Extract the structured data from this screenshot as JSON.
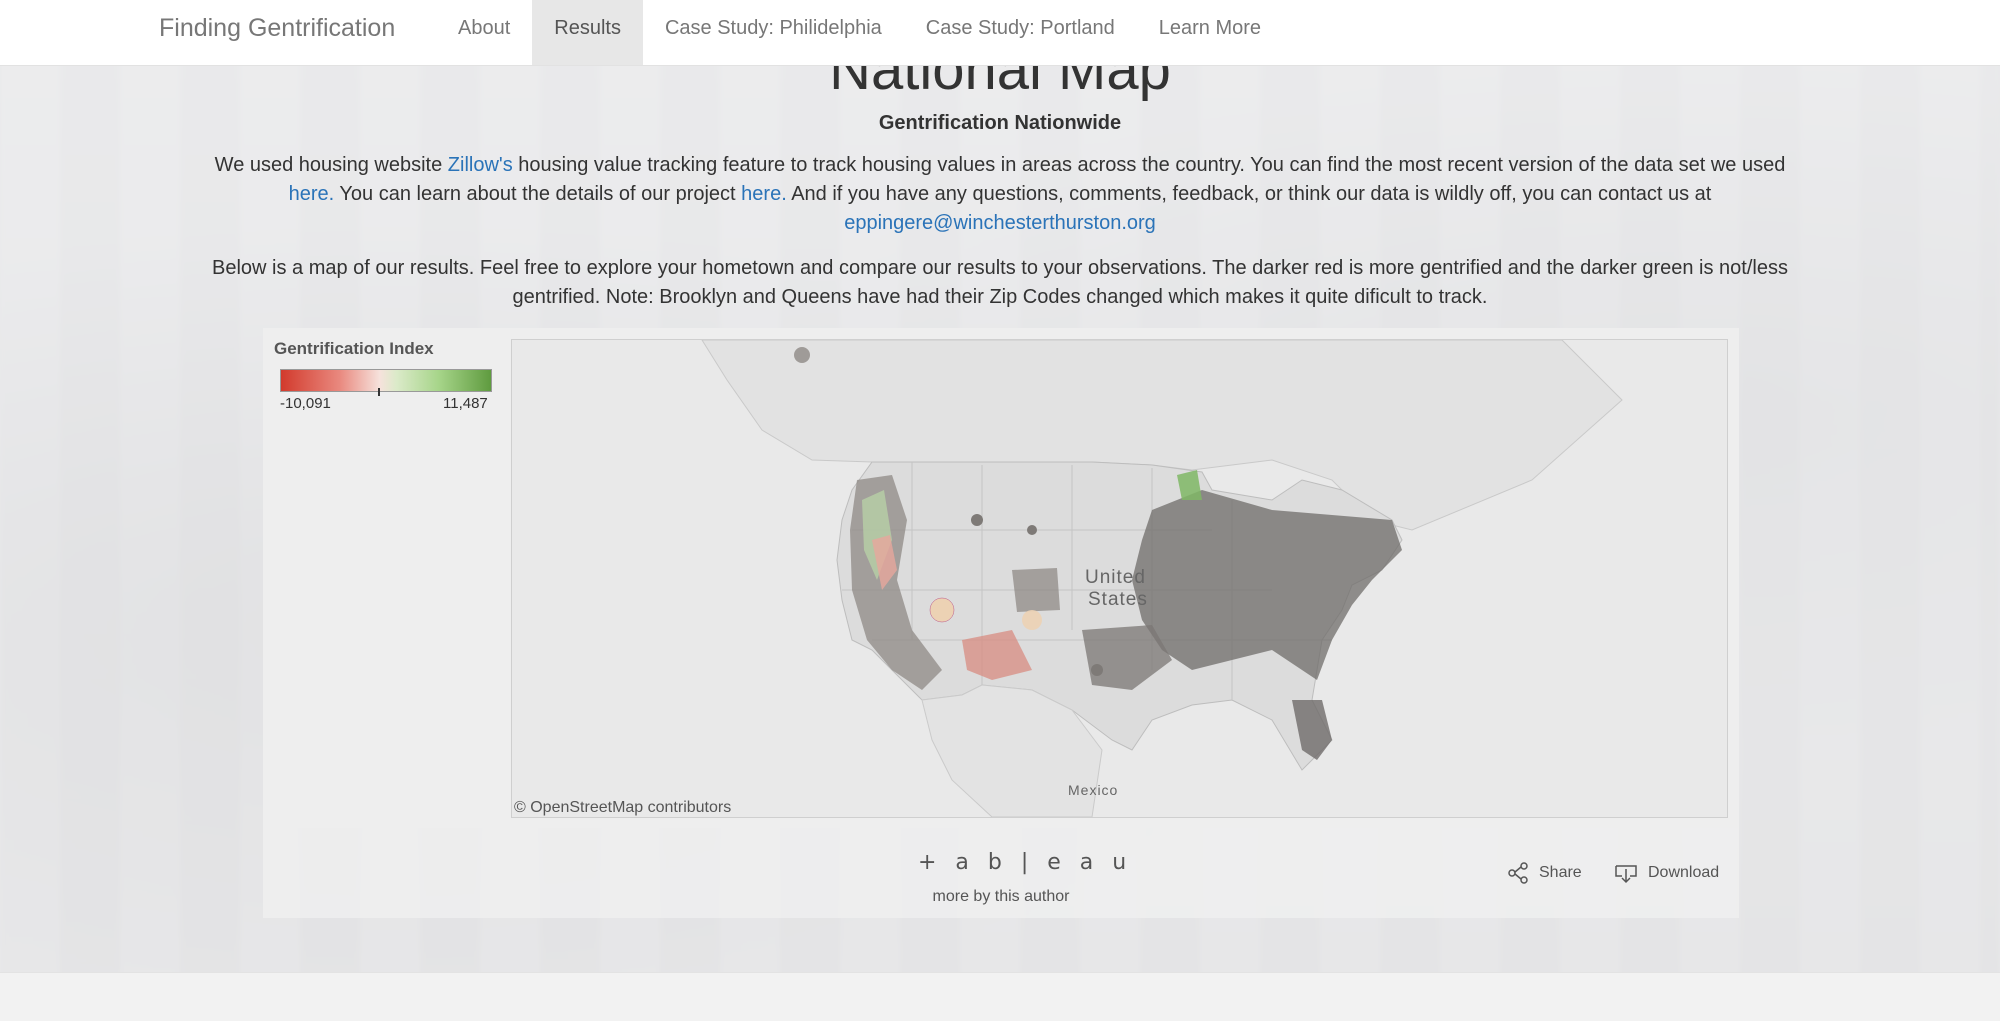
{
  "nav": {
    "brand": "Finding Gentrification",
    "items": [
      {
        "label": "About",
        "active": false
      },
      {
        "label": "Results",
        "active": true
      },
      {
        "label": "Case Study: Philidelphia",
        "active": false
      },
      {
        "label": "Case Study: Portland",
        "active": false
      },
      {
        "label": "Learn More",
        "active": false
      }
    ]
  },
  "main": {
    "title": "National Map",
    "subtitle": "Gentrification Nationwide",
    "p1": {
      "t1": "We used housing website ",
      "link_zillow": "Zillow's",
      "t2": " housing value tracking feature to track housing values in areas across the country. You can find the most recent version of the data set we used ",
      "link_here1": "here.",
      "t3": " You can learn about the details of our project ",
      "link_here2": "here.",
      "t4": " And if you have any questions, comments, feedback, or think our data is wildly off, you can contact us at ",
      "email": "eppingere@winchesterthurston.org"
    },
    "p2": "Below is a map of our results. Feel free to explore your hometown and compare our results to your observations. The darker red is more gentrified and the darker green is not/less gentrified. Note: Brooklyn and Queens have had their Zip Codes changed which makes it quite dificult to track."
  },
  "viz": {
    "legend_title": "Gentrification Index",
    "legend_min": "-10,091",
    "legend_max": "11,487",
    "map_label_country": "United States",
    "map_label_mexico": "Mexico",
    "attribution": "© OpenStreetMap contributors",
    "colors": {
      "low": "#d23a2c",
      "mid": "#f6e2dc",
      "high": "#5f9b3f"
    }
  },
  "toolbar": {
    "logo": "+ a b | e a u",
    "more_by": "more by this author",
    "share": "Share",
    "download": "Download"
  }
}
